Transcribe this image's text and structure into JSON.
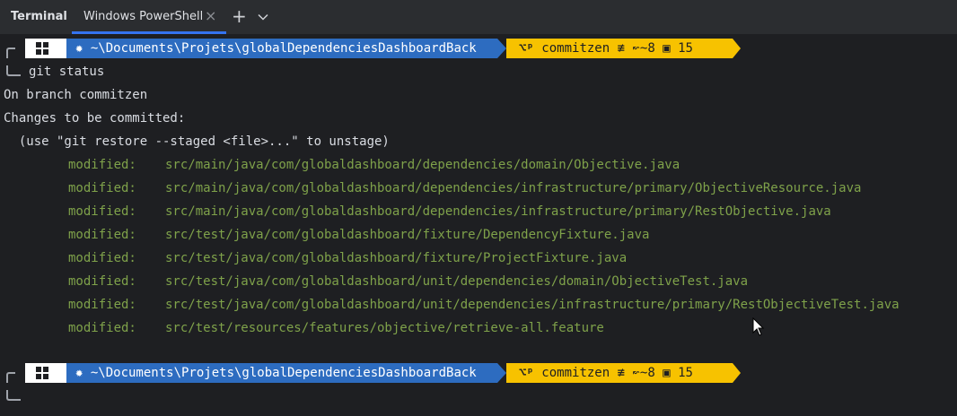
{
  "tabs": {
    "terminal_label": "Terminal",
    "powershell_label": "Windows PowerShell",
    "close_glyph": "×",
    "add_glyph": "+"
  },
  "prompt": {
    "path": "~\\Documents\\Projets\\globalDependenciesDashboardBack",
    "path_icon": "gear-icon",
    "branch_icon": "github-icon",
    "branch": "commitzen",
    "status_glyph": "≢",
    "ahead": "~8",
    "stash": "15",
    "colors": {
      "path_bg": "#2d6cc0",
      "git_bg": "#f7c200"
    }
  },
  "command": "git status",
  "output": {
    "line1": "On branch commitzen",
    "line2": "Changes to be committed:",
    "line3": "  (use \"git restore --staged <file>...\" to unstage)",
    "modified_label": "modified:",
    "files": [
      "src/main/java/com/globaldashboard/dependencies/domain/Objective.java",
      "src/main/java/com/globaldashboard/dependencies/infrastructure/primary/ObjectiveResource.java",
      "src/main/java/com/globaldashboard/dependencies/infrastructure/primary/RestObjective.java",
      "src/test/java/com/globaldashboard/fixture/DependencyFixture.java",
      "src/test/java/com/globaldashboard/fixture/ProjectFixture.java",
      "src/test/java/com/globaldashboard/unit/dependencies/domain/ObjectiveTest.java",
      "src/test/java/com/globaldashboard/unit/dependencies/infrastructure/primary/RestObjectiveTest.java",
      "src/test/resources/features/objective/retrieve-all.feature"
    ]
  }
}
